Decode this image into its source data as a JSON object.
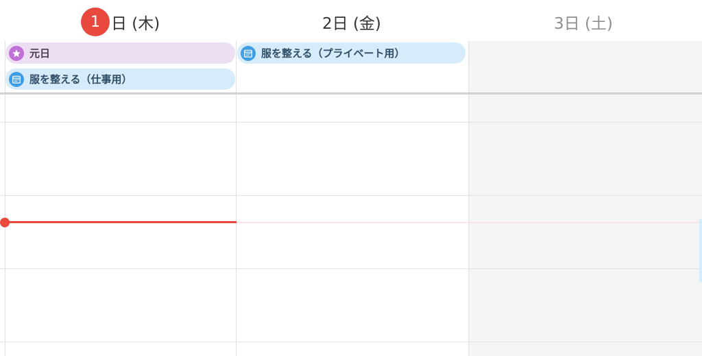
{
  "header": {
    "today_number": "1",
    "today_suffix": "日 (木)",
    "friday_label": "2日 (金)",
    "saturday_label": "3日 (土)"
  },
  "all_day_events": {
    "holiday": {
      "title": "元日",
      "icon": "star-icon",
      "color": "#bf6fd6"
    },
    "work": {
      "title": "服を整える（仕事用）",
      "icon": "calendar-icon",
      "color": "#3d9de6"
    },
    "private": {
      "title": "服を整える（プライベート用）",
      "icon": "calendar-icon",
      "color": "#3d9de6"
    }
  },
  "colors": {
    "accent_red": "#e8483d",
    "event_blue_bg": "#d7ecfa",
    "event_purple_bg": "#eddff3",
    "weekend_shade": "#f4f4f4"
  }
}
